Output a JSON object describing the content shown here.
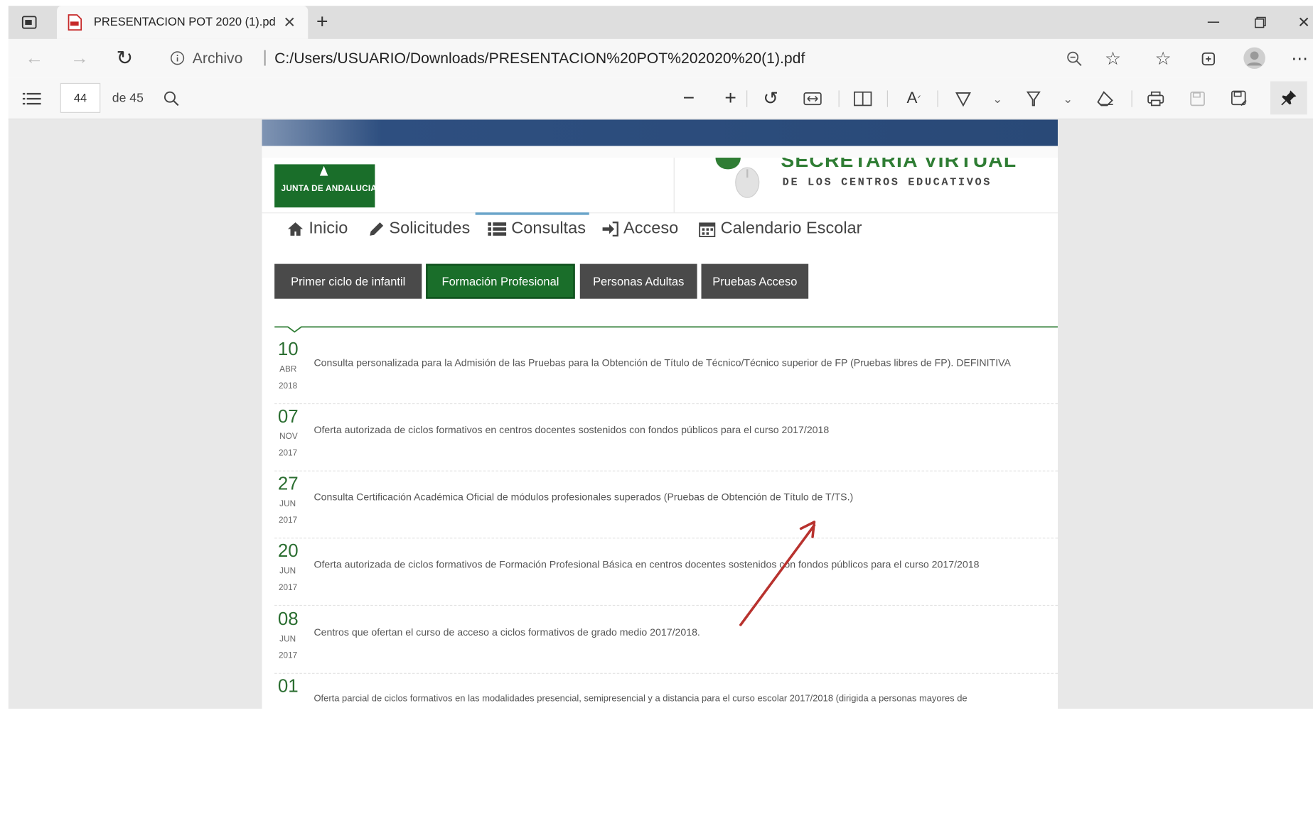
{
  "browser": {
    "tab_title": "PRESENTACION POT 2020 (1).pd",
    "address_scheme_label": "Archivo",
    "address_path": "C:/Users/USUARIO/Downloads/PRESENTACION%20POT%202020%20(1).pdf",
    "window_controls": [
      "minimize",
      "restore",
      "close"
    ]
  },
  "pdf_toolbar": {
    "page_number": "44",
    "page_total": "de 45"
  },
  "page": {
    "logo_text": "JUNTA DE ANDALUCIA",
    "brand_top": "SECRETARIA VIRTUAL",
    "brand_sub": "DE LOS CENTROS EDUCATIVOS",
    "nav": [
      {
        "label": "Inicio",
        "icon": "home-icon"
      },
      {
        "label": "Solicitudes",
        "icon": "pencil-icon"
      },
      {
        "label": "Consultas",
        "icon": "list-icon",
        "active": true
      },
      {
        "label": "Acceso",
        "icon": "sign-in-icon"
      },
      {
        "label": "Calendario Escolar",
        "icon": "calendar-icon"
      }
    ],
    "filters": [
      {
        "label": "Primer ciclo de infantil",
        "active": false
      },
      {
        "label": "Formación Profesional",
        "active": true
      },
      {
        "label": "Personas Adultas",
        "active": false
      },
      {
        "label": "Pruebas Acceso",
        "active": false
      }
    ],
    "items": [
      {
        "day": "10",
        "month": "ABR",
        "year": "2018",
        "text": "Consulta personalizada para la Admisión de las Pruebas para la Obtención de Título de Técnico/Técnico superior de FP (Pruebas libres de FP). DEFINITIVA"
      },
      {
        "day": "07",
        "month": "NOV",
        "year": "2017",
        "text": "Oferta autorizada de ciclos formativos en centros docentes sostenidos con fondos públicos para el curso 2017/2018"
      },
      {
        "day": "27",
        "month": "JUN",
        "year": "2017",
        "text": "Consulta Certificación Académica Oficial de módulos profesionales superados (Pruebas de Obtención de Título de T/TS.)"
      },
      {
        "day": "20",
        "month": "JUN",
        "year": "2017",
        "text": "Oferta autorizada de ciclos formativos de Formación Profesional Básica en centros docentes sostenidos con fondos públicos para el curso 2017/2018"
      },
      {
        "day": "08",
        "month": "JUN",
        "year": "2017",
        "text": "Centros que ofertan el curso de acceso a ciclos formativos de grado medio 2017/2018."
      },
      {
        "day": "01",
        "month": "",
        "year": "",
        "text": "Oferta parcial de ciclos formativos en las modalidades presencial, semipresencial y a distancia para el curso escolar 2017/2018 (dirigida a personas mayores de"
      }
    ]
  },
  "colors": {
    "green": "#1a6e2a",
    "dark_pill": "#4a4a4a",
    "banner_blue": "#2c4c7c",
    "annotation_red": "#b8322e"
  }
}
